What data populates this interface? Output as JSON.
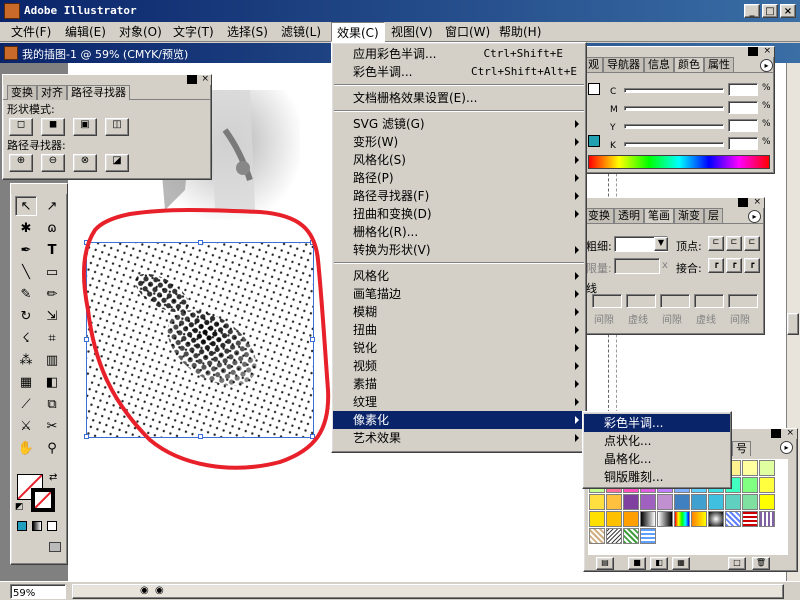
{
  "app": {
    "title": "Adobe Illustrator"
  },
  "menubar": [
    "文件(F)",
    "编辑(E)",
    "对象(O)",
    "文字(T)",
    "选择(S)",
    "滤镜(L)",
    "效果(C)",
    "视图(V)",
    "窗口(W)",
    "帮助(H)"
  ],
  "document": {
    "title": "我的插图-1 @ 59% (CMYK/预览)",
    "zoom": "59%"
  },
  "effect_menu": {
    "group1": [
      {
        "label": "应用彩色半调...",
        "shortcut": "Ctrl+Shift+E"
      },
      {
        "label": "彩色半调...",
        "shortcut": "Ctrl+Shift+Alt+E"
      }
    ],
    "group2": [
      {
        "label": "文档栅格效果设置(E)..."
      }
    ],
    "group3": [
      {
        "label": "SVG 滤镜(G)",
        "sub": true
      },
      {
        "label": "变形(W)",
        "sub": true
      },
      {
        "label": "风格化(S)",
        "sub": true
      },
      {
        "label": "路径(P)",
        "sub": true
      },
      {
        "label": "路径寻找器(F)",
        "sub": true
      },
      {
        "label": "扭曲和变换(D)",
        "sub": true
      },
      {
        "label": "栅格化(R)..."
      },
      {
        "label": "转换为形状(V)",
        "sub": true
      }
    ],
    "group4": [
      {
        "label": "风格化",
        "sub": true
      },
      {
        "label": "画笔描边",
        "sub": true
      },
      {
        "label": "模糊",
        "sub": true
      },
      {
        "label": "扭曲",
        "sub": true
      },
      {
        "label": "锐化",
        "sub": true
      },
      {
        "label": "视频",
        "sub": true
      },
      {
        "label": "素描",
        "sub": true
      },
      {
        "label": "纹理",
        "sub": true
      },
      {
        "label": "像素化",
        "sub": true,
        "highlighted": true
      },
      {
        "label": "艺术效果",
        "sub": true
      }
    ]
  },
  "pixelate_submenu": [
    "彩色半调...",
    "点状化...",
    "晶格化...",
    "铜版雕刻..."
  ],
  "pathfinder_panel": {
    "tabs": [
      "变换",
      "对齐",
      "路径寻找器"
    ],
    "shape_modes_label": "形状模式:",
    "pathfinders_label": "路径寻找器:"
  },
  "color_panel": {
    "tabs": [
      "观",
      "导航器",
      "信息",
      "颜色",
      "属性"
    ],
    "channels": [
      "C",
      "M",
      "Y",
      "K"
    ],
    "unit": "%"
  },
  "stroke_panel": {
    "tabs": [
      "变换",
      "透明",
      "笔画",
      "渐变",
      "层"
    ],
    "weight_label": "粗细:",
    "cap_label": "顶点:",
    "miter_label": "限量:",
    "join_label": "接合:",
    "miter_unit": "x",
    "dashed_label": "线",
    "dash_labels": [
      "间隙",
      "虚线",
      "间隙",
      "虚线",
      "间隙"
    ]
  },
  "swatch_panel": {
    "tab": "号"
  },
  "colors": {
    "titlebar": "#0a246a",
    "menu_highlight": "#0a246a",
    "selection": "#3b6fd6",
    "annotation": "#e8202a"
  }
}
